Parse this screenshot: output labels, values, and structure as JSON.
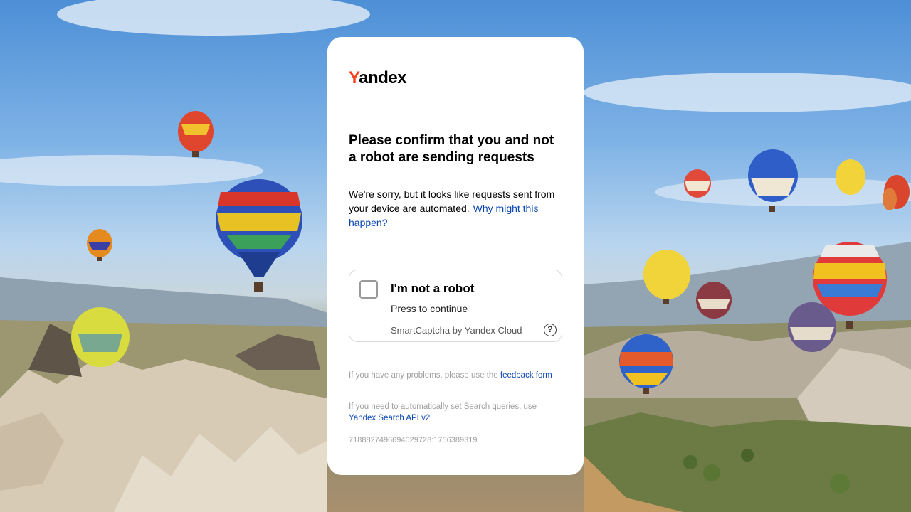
{
  "logo": {
    "y": "Y",
    "rest": "andex"
  },
  "title": "Please confirm that you and not a robot are sending requests",
  "description": {
    "text": "We're sorry, but it looks like requests sent from your device are automated.",
    "link": "Why might this happen?"
  },
  "captcha": {
    "label": "I'm not a robot",
    "subtext": "Press to continue",
    "brand": "SmartCaptcha by Yandex Cloud",
    "help_icon": "question-circle-icon",
    "help_glyph": "?"
  },
  "help": {
    "feedback_text": "If you have any problems, please use the",
    "feedback_link": "feedback form",
    "api_text": "If you need to automatically set Search queries, use",
    "api_link": "Yandex Search API v2"
  },
  "request_id": "7188827496694029728:1756389319",
  "colors": {
    "logo_accent": "#fc3f1d",
    "link": "#0a46b3",
    "muted_text": "#a0a0a0"
  }
}
